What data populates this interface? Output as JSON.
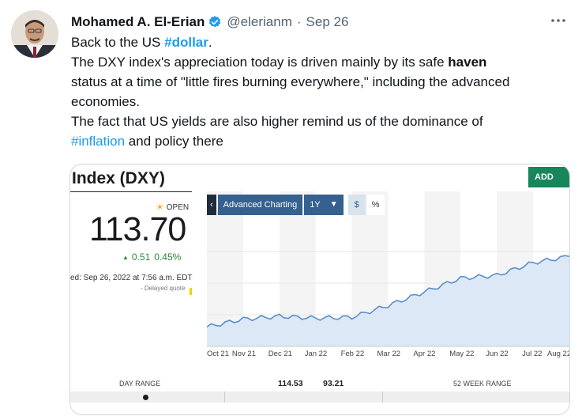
{
  "tweet": {
    "author_name": "Mohamed A. El-Erian",
    "handle": "@elerianm",
    "separator": "·",
    "date": "Sep 26",
    "text": {
      "l1_pre": "Back to the US ",
      "l1_tag": "#dollar",
      "l1_post": ".",
      "l2_pre": "The DXY index's appreciation today is driven mainly by its safe ",
      "l2_bold": "haven",
      "l3": "status at a time of \"little fires burning everywhere,\" including the advanced",
      "l4": "economies.",
      "l5": "The fact that US yields are also higher remind us of the dominance of",
      "l6_tag": "#inflation",
      "l6_post": " and policy there"
    }
  },
  "card": {
    "title": "Index (DXY)",
    "add_button": "ADD",
    "status": "OPEN",
    "price": "113.70",
    "change": "0.51",
    "change_pct": "0.45%",
    "updated": "ed: Sep 26, 2022 at 7:56 a.m. EDT",
    "delayed": "- Delayed quote",
    "toolbar": {
      "back": "‹",
      "advanced": "Advanced Charting",
      "range": "1Y",
      "currency": "$",
      "percent": "%"
    },
    "day_range_label": "DAY RANGE",
    "week_range_label": "52 WEEK RANGE",
    "low": "114.53",
    "high": "93.21"
  },
  "colors": {
    "link": "#1d9bf0",
    "verified": "#1d9bf0",
    "chart_line": "#5b8fcb",
    "chart_fill": "#dce8f5",
    "positive": "#2d8a3a",
    "add_button": "#18865b"
  },
  "chart_data": {
    "type": "area",
    "x": [
      "Oct 21",
      "Nov 21",
      "Dec 21",
      "Jan 22",
      "Feb 22",
      "Mar 22",
      "Apr 22",
      "May 22",
      "Jun 22",
      "Jul 22",
      "Aug 22"
    ],
    "values": [
      94.0,
      95.6,
      96.2,
      95.8,
      96.0,
      98.4,
      101.2,
      104.0,
      104.6,
      107.2,
      108.5
    ],
    "ylim": [
      90,
      116
    ],
    "grid": true
  }
}
